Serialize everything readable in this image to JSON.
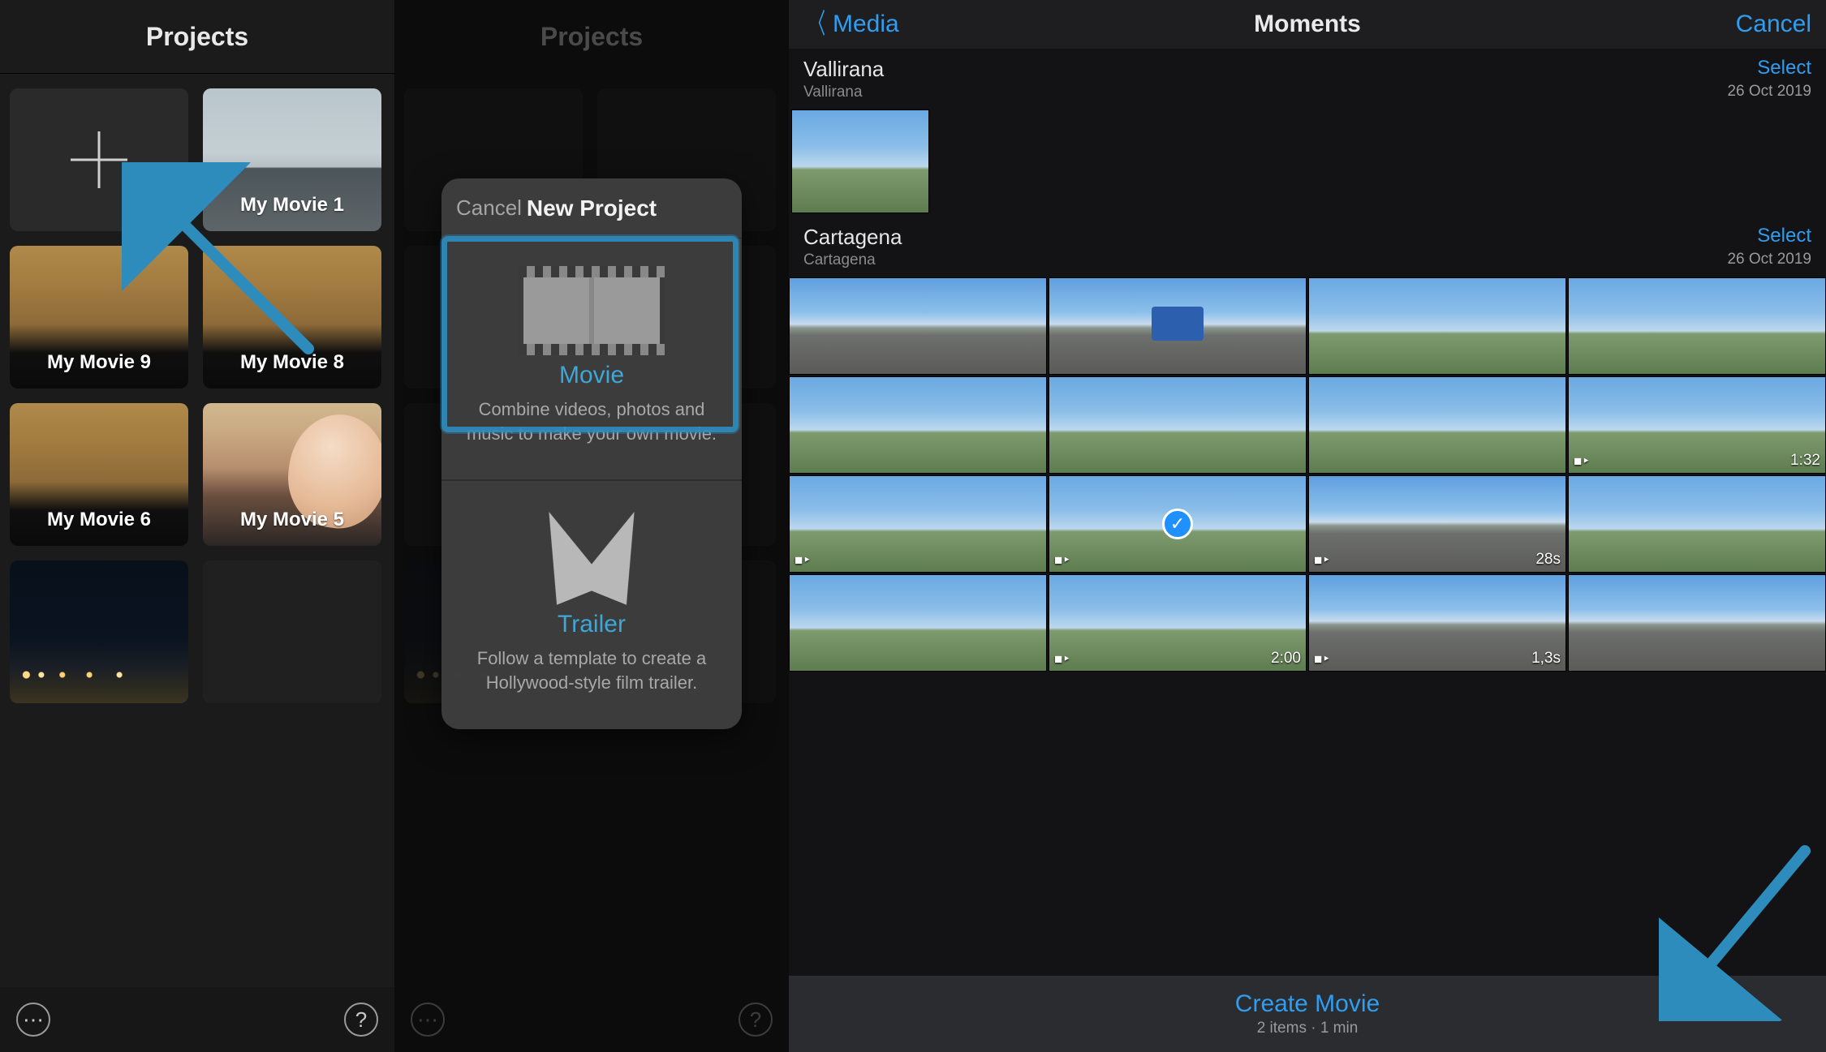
{
  "panel1": {
    "title": "Projects",
    "tiles": [
      {
        "kind": "new"
      },
      {
        "kind": "beach",
        "label": "My Movie 1"
      },
      {
        "kind": "forest",
        "label": "My Movie 9"
      },
      {
        "kind": "forest",
        "label": "My Movie 8"
      },
      {
        "kind": "forest",
        "label": "My Movie 6"
      },
      {
        "kind": "person",
        "label": "My Movie 5"
      },
      {
        "kind": "night",
        "label": ""
      },
      {
        "kind": "plain",
        "label": ""
      }
    ],
    "more_icon": "more-icon",
    "help_icon": "help-icon"
  },
  "panel2": {
    "title": "Projects",
    "sheet": {
      "cancel": "Cancel",
      "title": "New Project",
      "movie": {
        "title": "Movie",
        "desc": "Combine videos, photos and music to make your own movie."
      },
      "trailer": {
        "title": "Trailer",
        "desc": "Follow a template to create a Hollywood-style film trailer."
      }
    }
  },
  "panel3": {
    "back": "Media",
    "title": "Moments",
    "cancel": "Cancel",
    "moments": [
      {
        "name": "Vallirana",
        "sub": "Vallirana",
        "select": "Select",
        "date": "26 Oct 2019",
        "thumbs": [
          {
            "type": "landscape",
            "w": 168,
            "h": 126
          }
        ]
      },
      {
        "name": "Cartagena",
        "sub": "Cartagena",
        "select": "Select",
        "date": "26 Oct 2019"
      }
    ],
    "grid": [
      {
        "type": "road"
      },
      {
        "type": "road",
        "sign": true
      },
      {
        "type": "sky"
      },
      {
        "type": "sky"
      },
      {
        "type": "sky"
      },
      {
        "type": "sky"
      },
      {
        "type": "sky"
      },
      {
        "type": "sky",
        "cam": true,
        "duration": "1:32"
      },
      {
        "type": "sky",
        "cam": true
      },
      {
        "type": "sky",
        "cam": true,
        "selected": true
      },
      {
        "type": "road",
        "cam": true,
        "duration": "28s"
      },
      {
        "type": "sky"
      },
      {
        "type": "sky"
      },
      {
        "type": "sky",
        "cam": true,
        "duration": "2:00"
      },
      {
        "type": "road",
        "cam": true,
        "duration": "1,3s"
      },
      {
        "type": "road"
      }
    ],
    "create": {
      "label": "Create Movie",
      "meta": "2 items · 1 min"
    }
  },
  "colors": {
    "accent": "#2f9ef2",
    "crayon": "#2e8cbc"
  }
}
